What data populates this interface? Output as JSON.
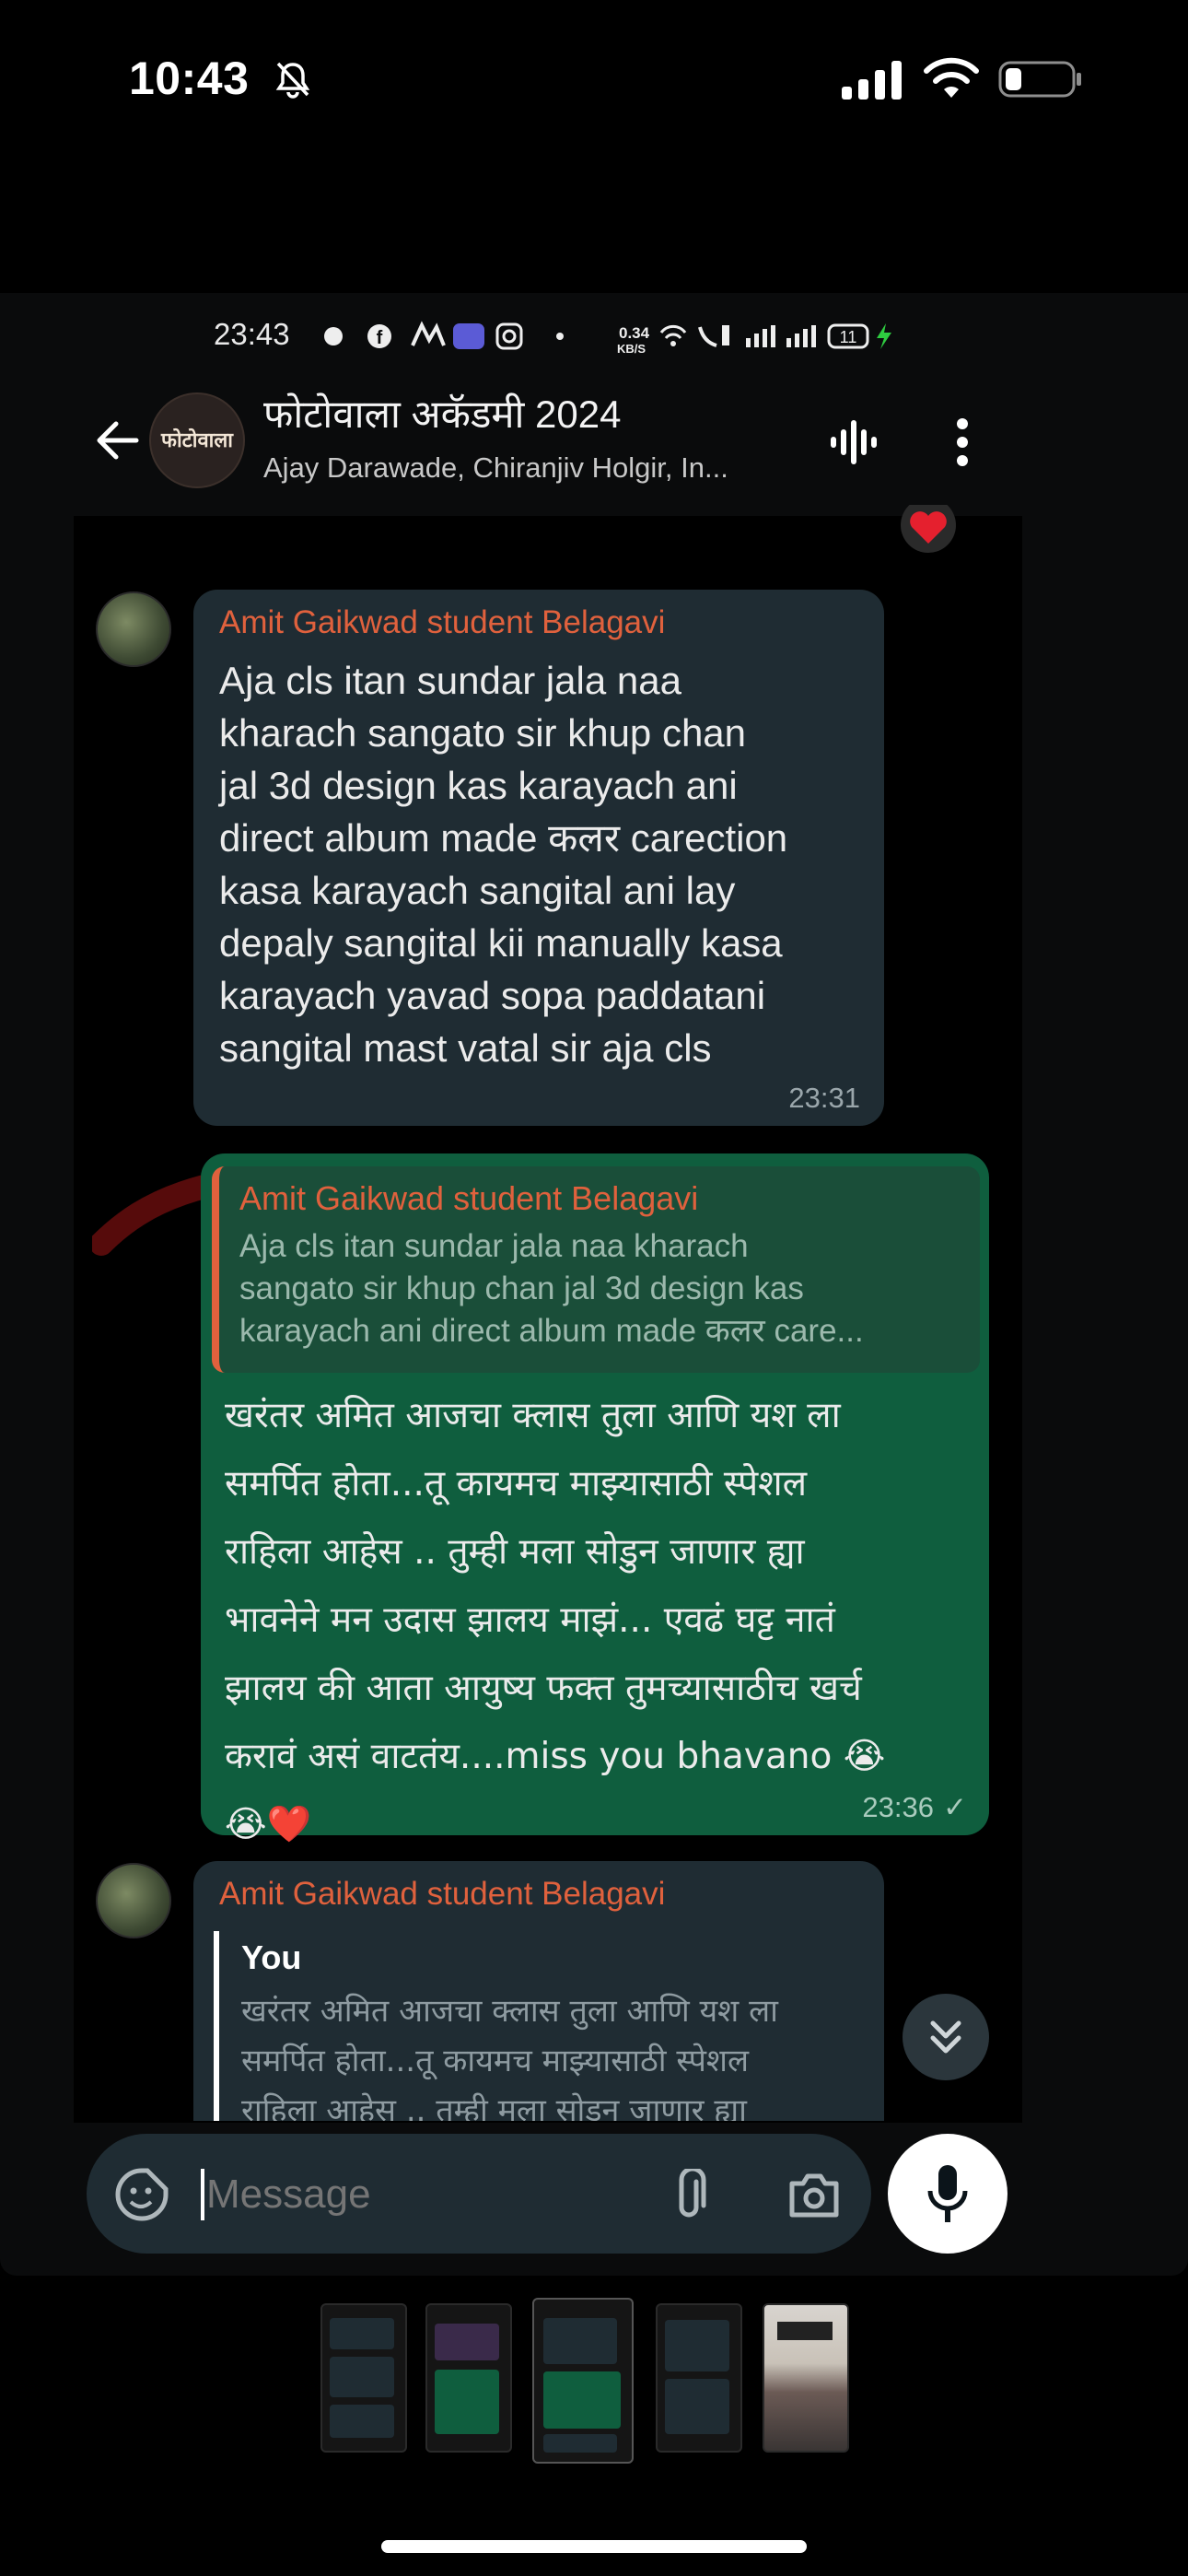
{
  "ios_status": {
    "time": "10:43"
  },
  "inner_status": {
    "time": "23:43",
    "speed": "0.34",
    "speed_unit": "KB/S",
    "battery": "11"
  },
  "header": {
    "avatar_text": "फोटोवाला",
    "group_name": "फोटोवाला अकॅडमी 2024",
    "members": "Ajay Darawade, Chiranjiv Holgir, In..."
  },
  "messages": [
    {
      "sender": "Amit Gaikwad student Belagavi",
      "lines": [
        "Aja cls itan sundar jala naa",
        "kharach sangato sir khup chan",
        "jal 3d design kas karayach ani",
        "direct album made कलर carection",
        "kasa karayach sangital ani lay",
        "depaly sangital kii manually kasa",
        "karayach yavad sopa paddatani",
        "sangital mast vatal sir aja cls"
      ],
      "time": "23:31"
    },
    {
      "quote_sender": "Amit Gaikwad student Belagavi",
      "quote_lines": [
        "Aja cls itan sundar jala naa kharach",
        "sangato sir khup chan jal 3d design kas",
        "karayach ani  direct album made कलर care..."
      ],
      "lines": [
        "खरंतर अमित आजचा क्लास तुला आणि यश ला",
        "समर्पित होता...तू कायमच माझ्यासाठी स्पेशल",
        "राहिला आहेस .. तुम्ही मला सोडुन जाणार  ह्या",
        "भावनेने मन उदास झालय माझं... एवढं घट्ट नातं",
        "झालय की आता आयुष्य फक्त तुमच्यासाठीच खर्च",
        "करावं असं वाटतंय....miss you bhavano 😭",
        "😭❤️"
      ],
      "time": "23:36",
      "status": "✓"
    },
    {
      "sender": "Amit Gaikwad student Belagavi",
      "quote_sender": "You",
      "quote_lines": [
        "खरंतर अमित आजचा क्लास तुला आणि यश ला",
        "समर्पित होता...तू कायमच माझ्यासाठी स्पेशल",
        "राहिला आहेस .. तुम्ही मला सोडुन जाणार  ह्या"
      ]
    }
  ],
  "input": {
    "placeholder": "Message"
  },
  "icons": [
    "bell-slash-icon",
    "cellular-signal-icon",
    "wifi-icon",
    "battery-icon",
    "back-arrow-icon",
    "voice-chat-icon",
    "more-vert-icon",
    "heart-icon",
    "sticker-icon",
    "attach-icon",
    "camera-icon",
    "mic-icon",
    "double-chevron-down-icon"
  ],
  "colors": {
    "sender": "#e0613d",
    "incoming_bubble": "#1f2c33",
    "outgoing_bubble": "#0f5e3e",
    "background": "#000000"
  }
}
